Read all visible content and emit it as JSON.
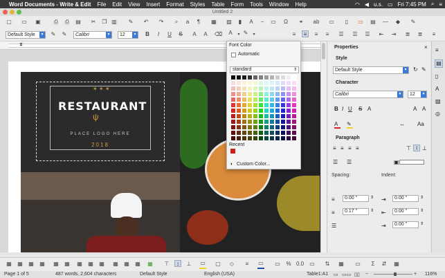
{
  "menubar": {
    "apple": "",
    "app_name": "Word Documents - Write & Edit",
    "items": [
      "File",
      "Edit",
      "View",
      "Insert",
      "Format",
      "Styles",
      "Table",
      "Form",
      "Tools",
      "Window",
      "Help"
    ],
    "status_right": [
      "u.s.",
      "Fri 7:45 PM"
    ]
  },
  "window": {
    "title": "Untitled 2"
  },
  "formatting": {
    "paragraph_style": "Default Style",
    "font_name": "Calibri",
    "font_size": "12",
    "bold": "B",
    "italic": "I",
    "underline": "U",
    "strike": "S",
    "superscript": "A",
    "subscript": "A",
    "font_color_swatch": "#e02020",
    "highlight_swatch": "#f2d21a"
  },
  "font_color_popup": {
    "title": "Font Color",
    "automatic_label": "Automatic",
    "palette_name": "standard",
    "recent_label": "Recent",
    "recent_color": "#c9211e",
    "custom_label": "Custom Color..."
  },
  "sidebar": {
    "title": "Properties",
    "style_section": "Style",
    "style_value": "Default Style",
    "character_section": "Character",
    "font_value": "Calibri",
    "size_value": "12",
    "paragraph_section": "Paragraph",
    "spacing_label": "Spacing:",
    "indent_label": "Indent:",
    "spacing_above": "0.00 \"",
    "spacing_below": "0.17 \"",
    "indent_before": "0.00 \"",
    "indent_after": "0.00 \"",
    "indent_first": "0.00 \""
  },
  "document": {
    "logo_title": "RESTAURANT",
    "logo_tagline": "PLACE LOGO HERE",
    "logo_year": "2018"
  },
  "statusbar": {
    "page": "Page 1 of 5",
    "words": "487 words, 2,604 characters",
    "style": "Default Style",
    "language": "English (USA)",
    "cell": "Table1:A1",
    "zoom": "116%"
  }
}
